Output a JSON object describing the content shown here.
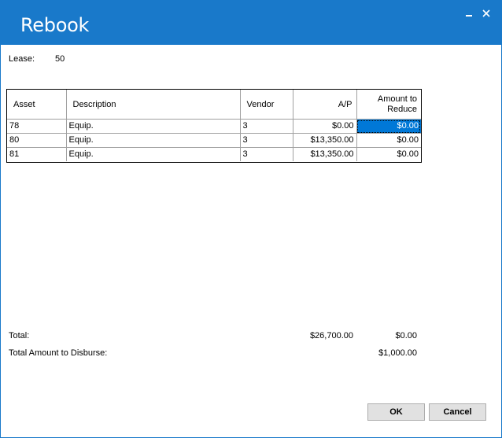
{
  "window": {
    "title": "Rebook",
    "accent_color": "#1979ca",
    "icons": [
      "minimize-icon",
      "close-icon"
    ]
  },
  "lease": {
    "label": "Lease:",
    "value": "50"
  },
  "grid": {
    "columns": [
      "Asset",
      "Description",
      "Vendor",
      "A/P",
      "Amount to Reduce"
    ],
    "rows": [
      {
        "asset": "78",
        "description": "Equip.",
        "vendor": "3",
        "ap": "$0.00",
        "reduce": "$0.00"
      },
      {
        "asset": "80",
        "description": "Equip.",
        "vendor": "3",
        "ap": "$13,350.00",
        "reduce": "$0.00"
      },
      {
        "asset": "81",
        "description": "Equip.",
        "vendor": "3",
        "ap": "$13,350.00",
        "reduce": "$0.00"
      }
    ],
    "selection_color": "#0078d7"
  },
  "totals": {
    "total_label": "Total:",
    "total_ap": "$26,700.00",
    "total_reduce": "$0.00",
    "disburse_label": "Total Amount to Disburse:",
    "disburse_value": "$1,000.00"
  },
  "buttons": {
    "ok": "OK",
    "cancel": "Cancel"
  }
}
